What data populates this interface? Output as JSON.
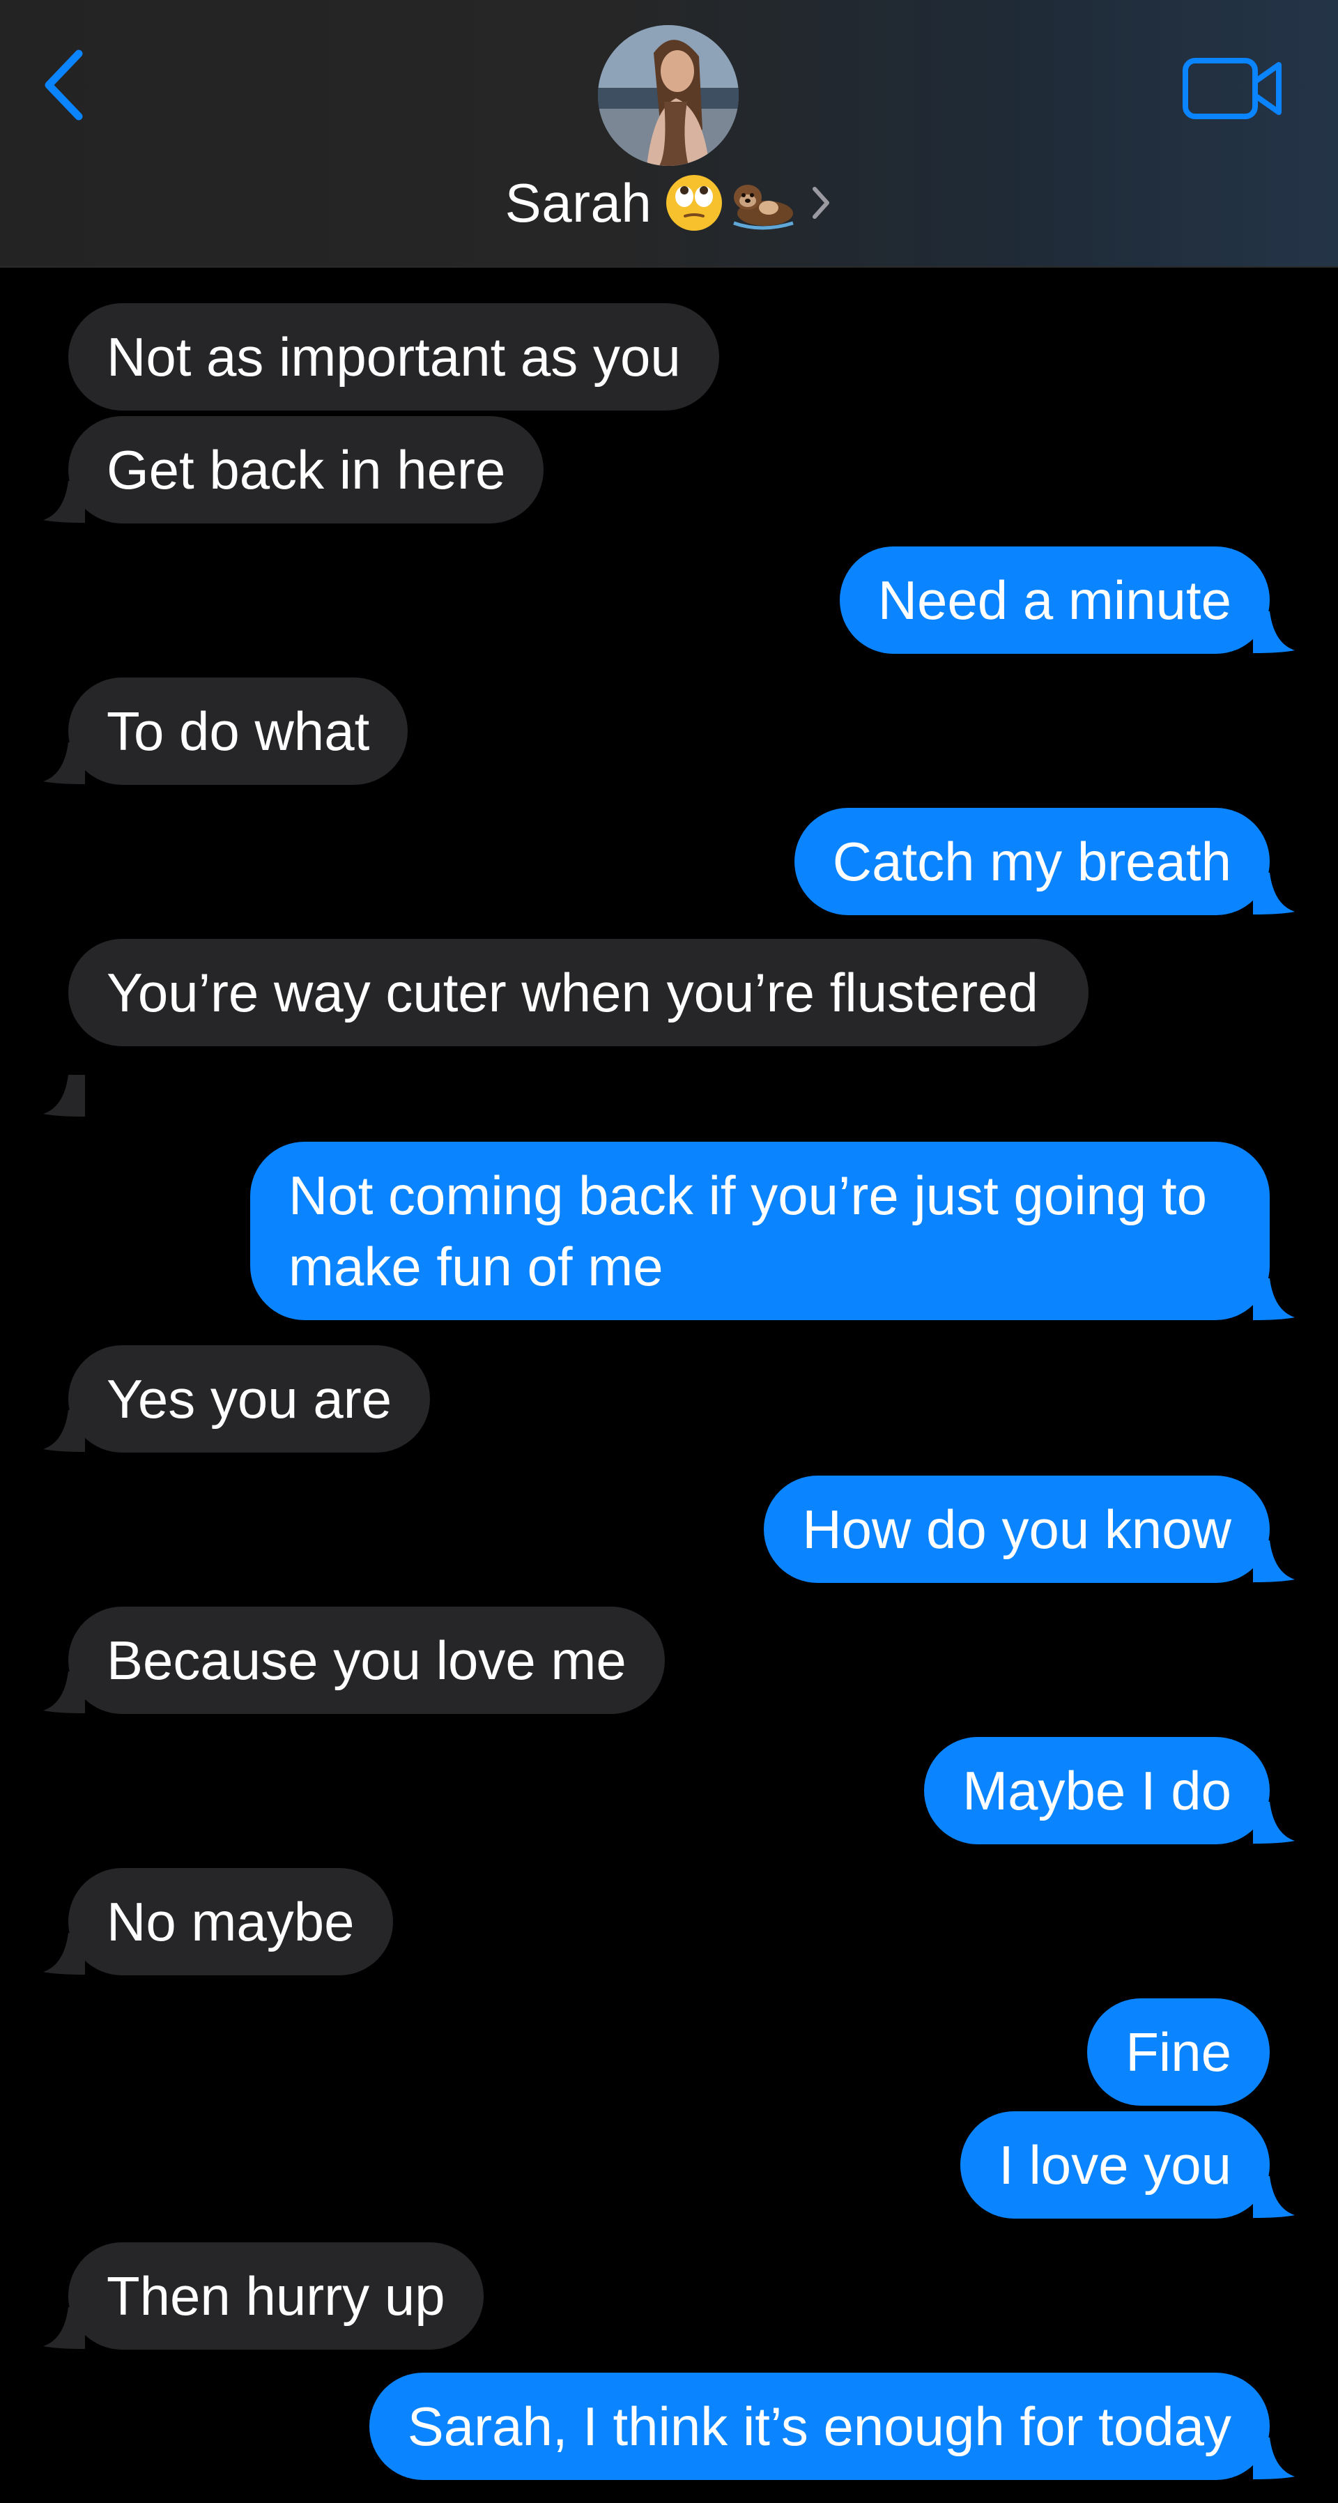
{
  "header": {
    "contact_name": "Sarah",
    "contact_emojis": [
      "face-with-rolling-eyes-emoji",
      "otter-emoji"
    ],
    "back_icon": "chevron-left-icon",
    "video_icon": "video-camera-icon",
    "disclosure_icon": "chevron-right-icon"
  },
  "colors": {
    "accent": "#0a84ff",
    "incoming_bubble": "#262629",
    "outgoing_bubble": "#0a84ff",
    "background": "#000000"
  },
  "messages": [
    {
      "dir": "in",
      "text": "Not as important as you"
    },
    {
      "dir": "in",
      "text": "Get back in here"
    },
    {
      "dir": "out",
      "text": "Need a minute"
    },
    {
      "dir": "in",
      "text": "To do what"
    },
    {
      "dir": "out",
      "text": "Catch my breath"
    },
    {
      "dir": "in",
      "text": "You’re way cuter when you’re flustered"
    },
    {
      "dir": "out",
      "text": "Not coming back if you’re just going to make fun of me"
    },
    {
      "dir": "in",
      "text": "Yes you are"
    },
    {
      "dir": "out",
      "text": "How do you know"
    },
    {
      "dir": "in",
      "text": "Because you love me"
    },
    {
      "dir": "out",
      "text": "Maybe I do"
    },
    {
      "dir": "in",
      "text": "No maybe"
    },
    {
      "dir": "out",
      "text": "Fine"
    },
    {
      "dir": "out",
      "text": "I love you"
    },
    {
      "dir": "in",
      "text": "Then hurry up"
    },
    {
      "dir": "out",
      "text": "Sarah, I think it’s enough for today"
    }
  ]
}
